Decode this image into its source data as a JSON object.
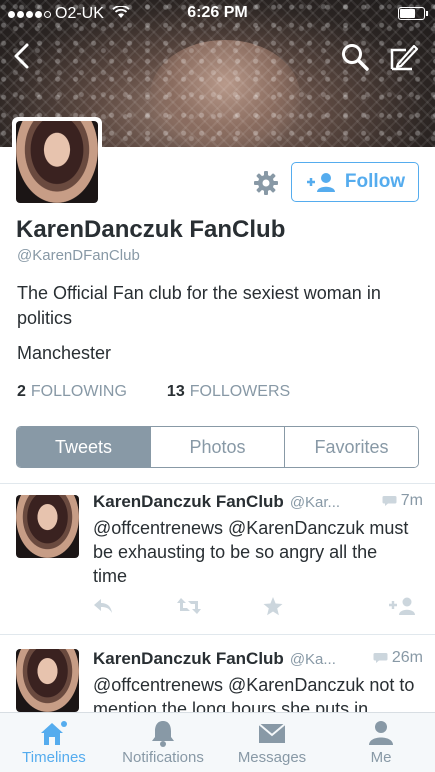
{
  "status_bar": {
    "carrier": "O2-UK",
    "time": "6:26 PM",
    "signal_bars": 4
  },
  "profile": {
    "name": "KarenDanczuk FanClub",
    "handle": "@KarenDFanClub",
    "bio": "The Official Fan club for the sexiest woman in politics",
    "location": "Manchester",
    "follow_label": "Follow",
    "following_count": "2",
    "following_label": "FOLLOWING",
    "followers_count": "13",
    "followers_label": "FOLLOWERS"
  },
  "tabs": [
    {
      "label": "Tweets",
      "active": true
    },
    {
      "label": "Photos",
      "active": false
    },
    {
      "label": "Favorites",
      "active": false
    }
  ],
  "tweets": [
    {
      "name": "KarenDanczuk FanClub",
      "handle": "@Kar...",
      "time": "7m",
      "text": "@offcentrenews @KarenDanczuk must be exhausting to be so angry all the time"
    },
    {
      "name": "KarenDanczuk FanClub",
      "handle": "@Ka...",
      "time": "26m",
      "text": "@offcentrenews @KarenDanczuk not to mention the long hours she puts in"
    }
  ],
  "bottom_nav": [
    {
      "label": "Timelines",
      "icon": "home-icon",
      "active": true
    },
    {
      "label": "Notifications",
      "icon": "bell-icon",
      "active": false
    },
    {
      "label": "Messages",
      "icon": "envelope-icon",
      "active": false
    },
    {
      "label": "Me",
      "icon": "person-icon",
      "active": false
    }
  ],
  "colors": {
    "accent": "#55acee",
    "muted": "#8899a6",
    "text": "#292f33"
  }
}
